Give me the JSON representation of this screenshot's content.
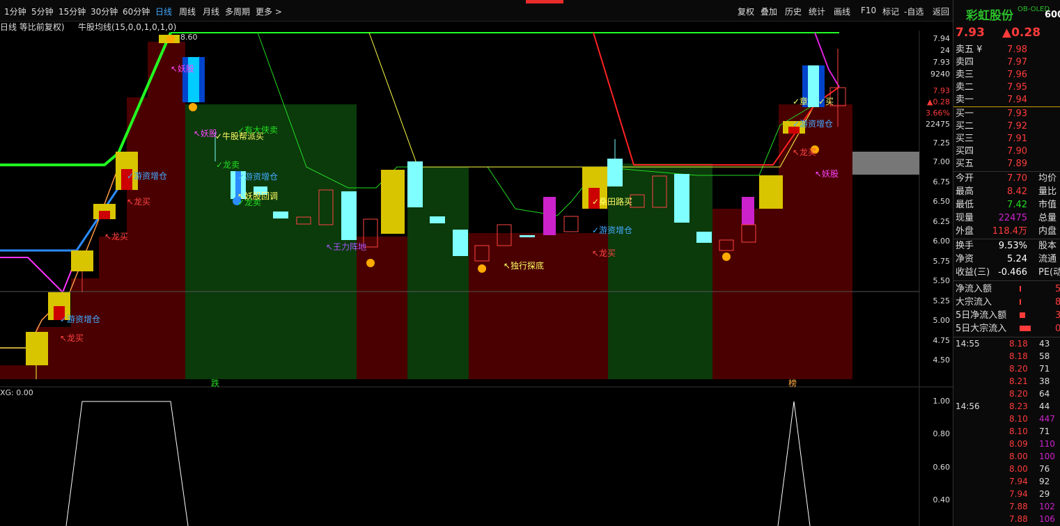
{
  "toolbar": {
    "timeframes": [
      "1分钟",
      "5分钟",
      "15分钟",
      "30分钟",
      "60分钟",
      "日线",
      "周线",
      "月线",
      "多周期",
      "更多 >"
    ],
    "active": "日线",
    "tools": [
      "复权",
      "叠加",
      "历史",
      "统计",
      "画线",
      "F10",
      "标记",
      "-自选",
      "返回"
    ]
  },
  "chart_header": {
    "title": "日线 等比前复权)",
    "indicator": "牛股均线(15,0,0,1,0,1,0)",
    "high_label": "8.60"
  },
  "main_chart": {
    "price_axis": [
      "7.94",
      "24",
      "7.93",
      "9240",
      "7.93",
      "▲0.28",
      "3.66%",
      "22475",
      "7.25",
      "7.00",
      "6.75",
      "6.50",
      "6.25",
      "6.00",
      "5.75",
      "5.50",
      "5.25",
      "5.00",
      "4.75",
      "4.50"
    ],
    "annotations": [
      "↖妖股",
      "↖妖股",
      "✓牛股帮派买",
      "✓有大侠卖",
      "✓龙卖",
      "✓游资增仓",
      "✓龙卖",
      "✓游资增仓",
      "↖龙买",
      "↖龙买",
      "✓游资增仓",
      "↖龙买",
      "✓游资增仓",
      "↖龙买",
      "↖妖股回调",
      "↖王力阵地",
      "↖独行探底",
      "✓桑田路买",
      "✓游资增仓",
      "↖龙买",
      "✓章",
      "✓买",
      "✓游资增仓",
      "↖龙买",
      "↖妖股"
    ],
    "bottom_tags": [
      "跌",
      "榜"
    ]
  },
  "sub_chart": {
    "label": "XG: 0.00",
    "axis": [
      "1.00",
      "0.80",
      "0.60",
      "0.40"
    ]
  },
  "panel": {
    "brand": "彩虹股份",
    "code": "600",
    "code_tag": "OB-OLED",
    "price": "7.93",
    "change": "▲0.28",
    "asks": [
      {
        "label": "卖五 ¥",
        "price": "7.98"
      },
      {
        "label": "卖四",
        "price": "7.97"
      },
      {
        "label": "卖三",
        "price": "7.96"
      },
      {
        "label": "卖二",
        "price": "7.95"
      },
      {
        "label": "卖一",
        "price": "7.94"
      }
    ],
    "bids": [
      {
        "label": "买一",
        "price": "7.93"
      },
      {
        "label": "买二",
        "price": "7.92"
      },
      {
        "label": "买三",
        "price": "7.91"
      },
      {
        "label": "买四",
        "price": "7.90"
      },
      {
        "label": "买五",
        "price": "7.89"
      }
    ],
    "stats": [
      {
        "label": "今开",
        "value": "7.70",
        "extra": "均价"
      },
      {
        "label": "最高",
        "value": "8.42",
        "extra": "量比"
      },
      {
        "label": "最低",
        "value": "7.42",
        "extra": "市值"
      },
      {
        "label": "现量",
        "value": "22475",
        "extra": "总量"
      },
      {
        "label": "外盘",
        "value": "118.4万",
        "extra": "内盘"
      },
      {
        "label": "换手",
        "value": "9.53%",
        "extra": "股本"
      },
      {
        "label": "净资",
        "value": "5.24",
        "extra": "流通"
      },
      {
        "label": "收益(三)",
        "value": "-0.466",
        "extra": "PE(动"
      }
    ],
    "flows": [
      {
        "label": "净流入额",
        "value": "5"
      },
      {
        "label": "大宗流入",
        "value": "8"
      },
      {
        "label": "5日净流入额",
        "value": "3"
      },
      {
        "label": "5日大宗流入",
        "value": "0"
      }
    ],
    "ticks": [
      {
        "time": "14:55",
        "price": "8.18",
        "vol": "43"
      },
      {
        "time": "",
        "price": "8.18",
        "vol": "58"
      },
      {
        "time": "",
        "price": "8.20",
        "vol": "71"
      },
      {
        "time": "",
        "price": "8.21",
        "vol": "38"
      },
      {
        "time": "",
        "price": "8.20",
        "vol": "64"
      },
      {
        "time": "14:56",
        "price": "8.23",
        "vol": "44"
      },
      {
        "time": "",
        "price": "8.10",
        "vol": "447"
      },
      {
        "time": "",
        "price": "8.10",
        "vol": "71"
      },
      {
        "time": "",
        "price": "8.09",
        "vol": "110"
      },
      {
        "time": "",
        "price": "8.00",
        "vol": "100"
      },
      {
        "time": "",
        "price": "8.00",
        "vol": "76"
      },
      {
        "time": "",
        "price": "7.94",
        "vol": "92"
      },
      {
        "time": "",
        "price": "7.94",
        "vol": "29"
      },
      {
        "time": "",
        "price": "7.88",
        "vol": "102"
      },
      {
        "time": "",
        "price": "7.88",
        "vol": "106"
      }
    ]
  }
}
